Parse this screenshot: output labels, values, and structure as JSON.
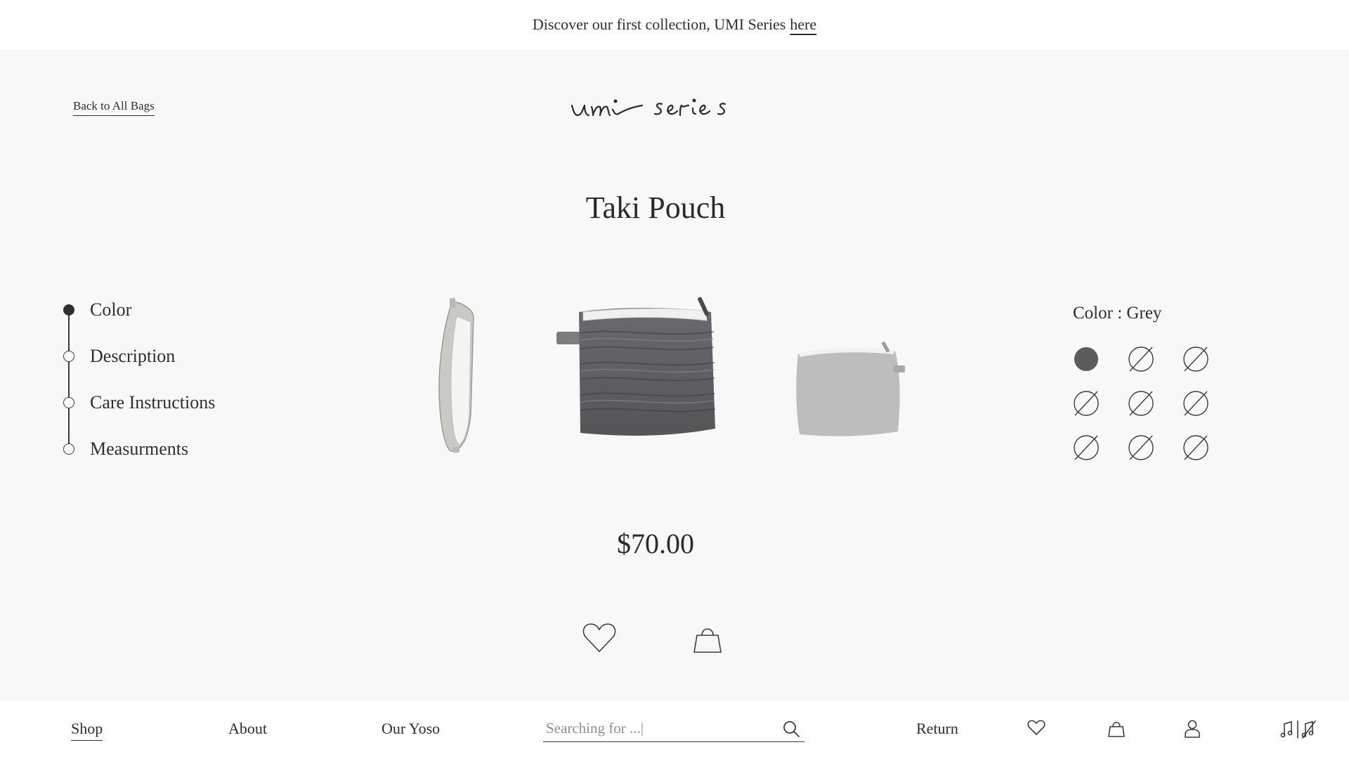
{
  "announcement": {
    "text": "Discover our first collection, UMI Series",
    "link_label": "here"
  },
  "header": {
    "back_link": "Back to All Bags",
    "logo_text": "umi series"
  },
  "product": {
    "title": "Taki Pouch",
    "price": "$70.00",
    "image_views": [
      "side-open-view",
      "front-pleated-view",
      "back-flat-view"
    ]
  },
  "sections": [
    {
      "label": "Color",
      "active": true
    },
    {
      "label": "Description",
      "active": false
    },
    {
      "label": "Care Instructions",
      "active": false
    },
    {
      "label": "Measurments",
      "active": false
    }
  ],
  "color_selector": {
    "label": "Color : Grey",
    "swatches": [
      {
        "state": "selected",
        "color": "#5c5c5c"
      },
      {
        "state": "unavailable"
      },
      {
        "state": "unavailable"
      },
      {
        "state": "unavailable"
      },
      {
        "state": "unavailable"
      },
      {
        "state": "unavailable"
      },
      {
        "state": "unavailable"
      },
      {
        "state": "unavailable"
      },
      {
        "state": "unavailable"
      }
    ]
  },
  "actions": {
    "wishlist_icon": "heart-icon",
    "bag_icon": "shopping-bag-icon"
  },
  "bottom_nav": {
    "shop": "Shop",
    "about": "About",
    "our_yoso": "Our Yoso",
    "search_placeholder": "Searching for ...|",
    "return": "Return",
    "icons": [
      "heart-icon",
      "bag-icon",
      "user-icon",
      "music-toggle-icon"
    ]
  },
  "colors": {
    "background": "#f8f8f8",
    "bar": "#ffffff",
    "text": "#2e2e2e",
    "product_grey": "#5c5c5c"
  }
}
